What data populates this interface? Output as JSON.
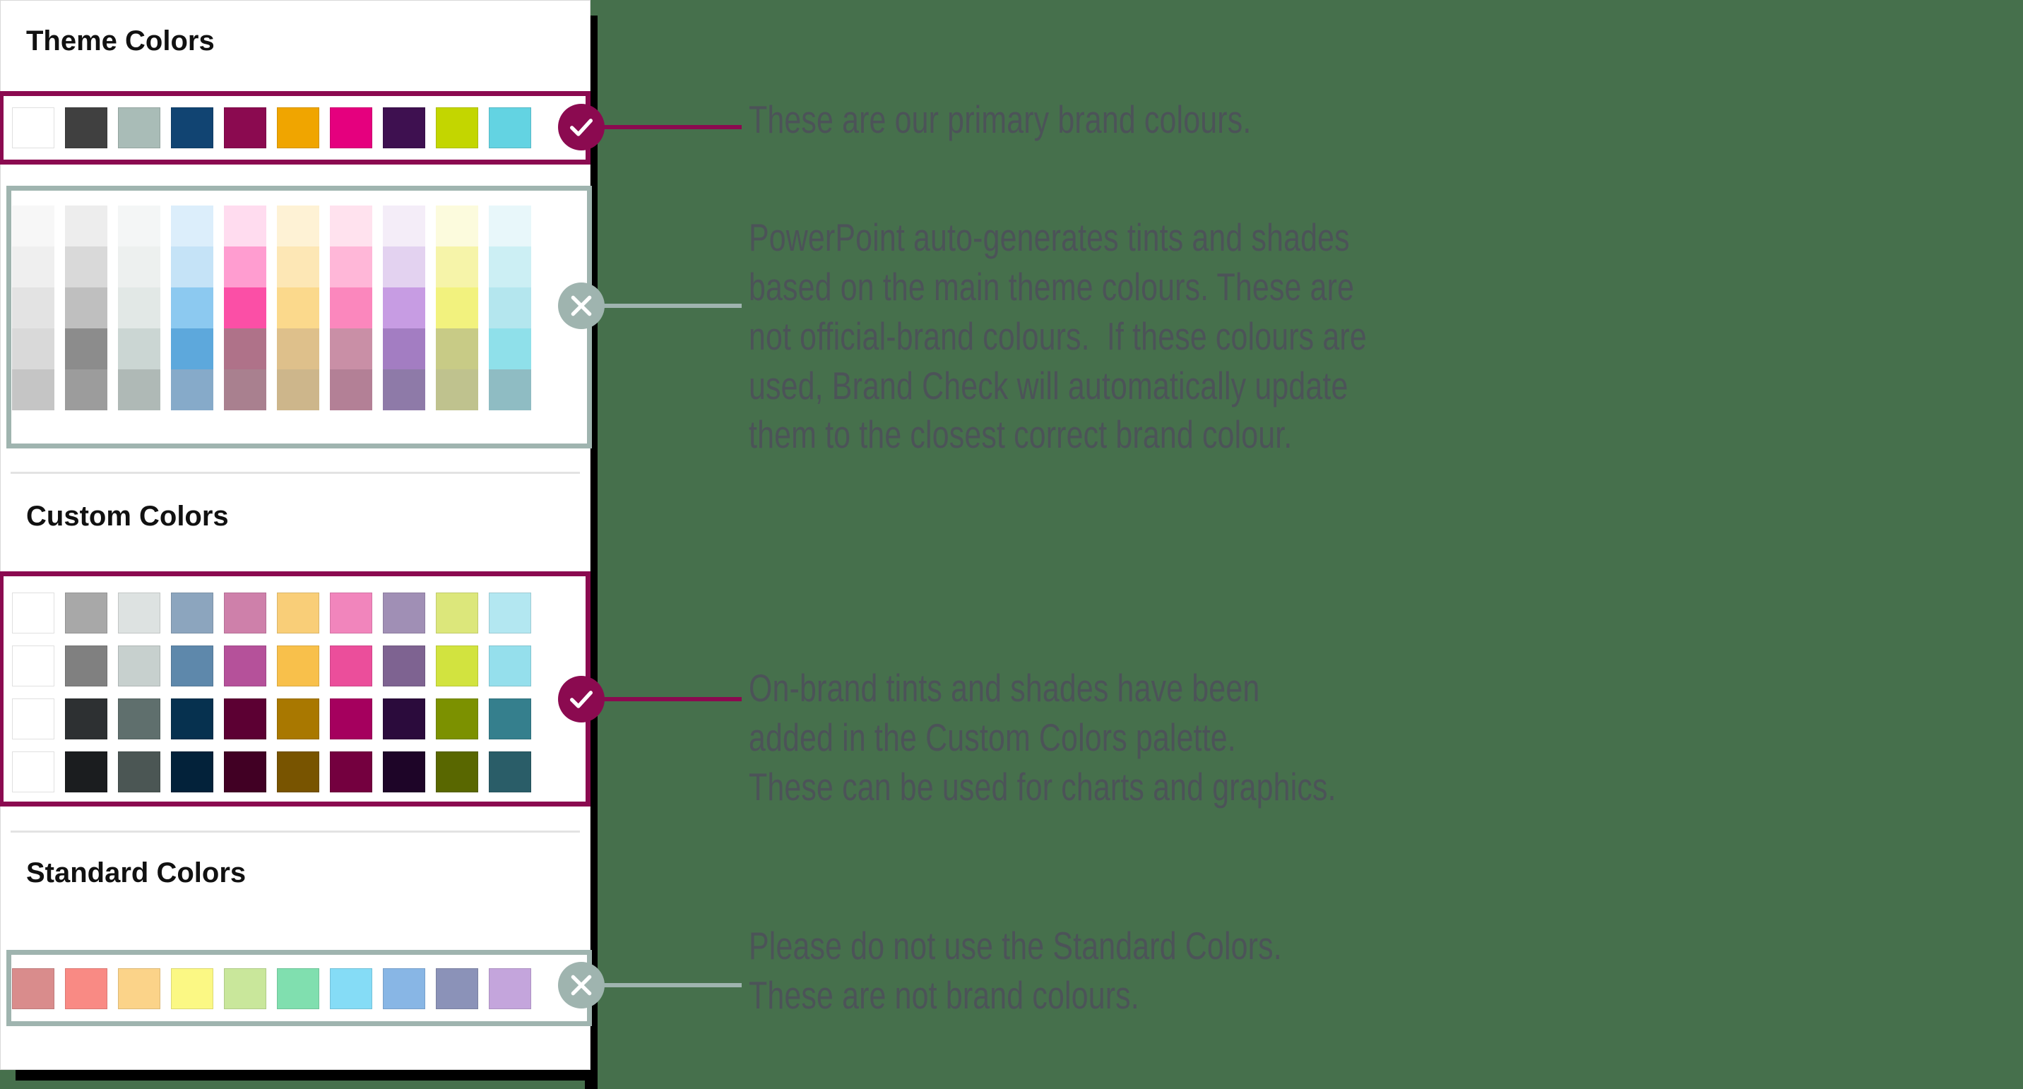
{
  "background_color": "#46704C",
  "accent_good": "#8B0A50",
  "accent_bad": "#9FB4AF",
  "annotation_text_color": "#4C5358",
  "panel": {
    "sections": {
      "theme": {
        "title": "Theme Colors"
      },
      "custom": {
        "title": "Custom Colors"
      },
      "standard": {
        "title": "Standard Colors"
      }
    }
  },
  "theme_colors": [
    "#FFFFFF",
    "#404040",
    "#A9BCB7",
    "#114472",
    "#8B0A50",
    "#F0A500",
    "#E5007E",
    "#3E1050",
    "#C3D600",
    "#63D3E2"
  ],
  "tints_grid": [
    [
      "#F7F7F7",
      "#EFEFEF",
      "#E3E3E3",
      "#D9D9D9",
      "#C5C5C5"
    ],
    [
      "#EDEDED",
      "#D9D9D9",
      "#BFBFBF",
      "#8C8C8C",
      "#9C9C9C"
    ],
    [
      "#F4F6F6",
      "#EDF0EF",
      "#E2E8E6",
      "#CBD6D3",
      "#AFB9B6"
    ],
    [
      "#DCEEFB",
      "#C5E3F7",
      "#8CC9F0",
      "#5DA8DC",
      "#86AAC9"
    ],
    [
      "#FFDCEF",
      "#FF9DD0",
      "#FB4FA6",
      "#AF7289",
      "#A9808F"
    ],
    [
      "#FEF2D5",
      "#FDE7B5",
      "#FBD98C",
      "#DEC08B",
      "#CDB68B"
    ],
    [
      "#FFE2EE",
      "#FFB7D8",
      "#FB87BD",
      "#C98FA6",
      "#B38096"
    ],
    [
      "#F4EDF8",
      "#E3D2F0",
      "#C79CE3",
      "#A37DC2",
      "#8E7AA8"
    ],
    [
      "#FCFBDD",
      "#F6F4A9",
      "#F2F27E",
      "#C8CB86",
      "#BFC28E"
    ],
    [
      "#E8F7FA",
      "#CCEFF4",
      "#B4E6EE",
      "#8FE0EA",
      "#8FBCC3"
    ]
  ],
  "custom_colors": [
    [
      "#FFFFFF",
      "#A8A8A8",
      "#DDE2E1",
      "#8CA5BE",
      "#CE80AA",
      "#F9CE78",
      "#F185BC",
      "#A08FB5",
      "#DCE77B",
      "#B3E7F1"
    ],
    [
      "#FFFFFF",
      "#808080",
      "#C7D0CE",
      "#5E88AB",
      "#B5519A",
      "#F8C04B",
      "#EB4E9B",
      "#7E6391",
      "#D2E33F",
      "#95DFEC"
    ],
    [
      "#FFFFFF",
      "#2D3032",
      "#5F6F6D",
      "#06314F",
      "#5C0033",
      "#A97800",
      "#A5005E",
      "#2B0B3C",
      "#7C9100",
      "#357F8D"
    ],
    [
      "#FFFFFF",
      "#1B1D1F",
      "#4B5654",
      "#03223A",
      "#410024",
      "#785400",
      "#74003F",
      "#1E0528",
      "#596700",
      "#2A5D68"
    ]
  ],
  "standard_colors": [
    "#D98C8C",
    "#F98A84",
    "#FBD389",
    "#FBF884",
    "#C9E79B",
    "#80DFAF",
    "#85DCF6",
    "#88B6E5",
    "#8B92B8",
    "#C4A5DC"
  ],
  "annotations": [
    {
      "id": "annot-1",
      "status": "good",
      "icon": "check-icon",
      "text": "These are our primary brand colours."
    },
    {
      "id": "annot-2",
      "status": "bad",
      "icon": "cross-icon",
      "text": "PowerPoint auto-generates tints and shades\nbased on the main theme colours. These are\nnot official-brand colours.  If these colours are\nused, Brand Check will automatically update\nthem to the closest correct brand colour."
    },
    {
      "id": "annot-3",
      "status": "good",
      "icon": "check-icon",
      "text": "On-brand tints and shades have been\nadded in the Custom Colors palette.\nThese can be used for charts and graphics."
    },
    {
      "id": "annot-4",
      "status": "bad",
      "icon": "cross-icon",
      "text": "Please do not use the Standard Colors.\nThese are not brand colours."
    }
  ]
}
